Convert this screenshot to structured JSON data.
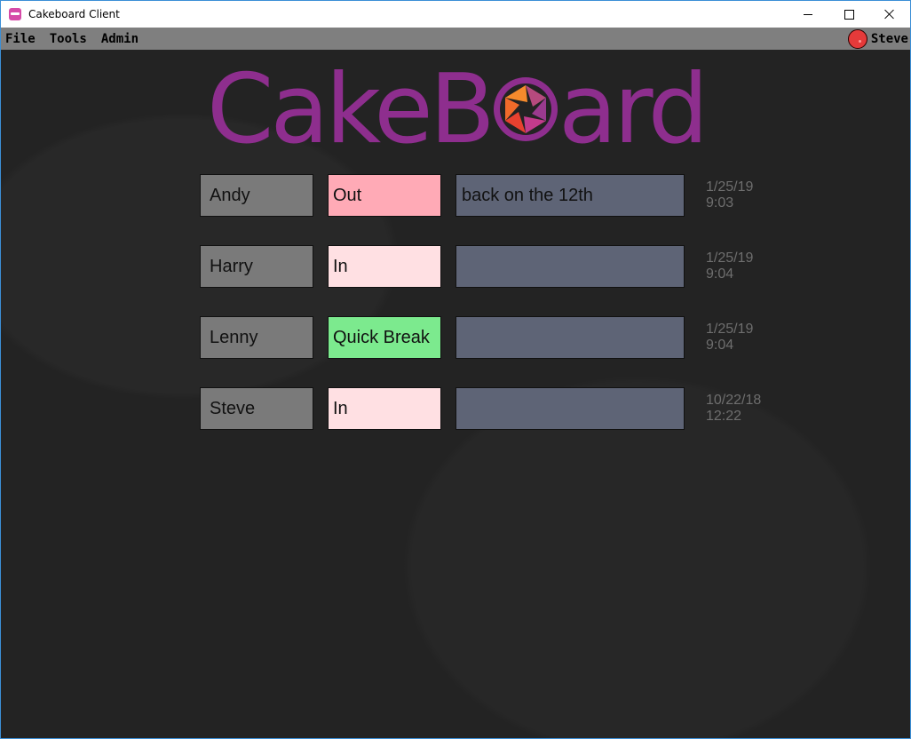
{
  "window": {
    "title": "Cakeboard Client"
  },
  "menu": {
    "file": "File",
    "tools": "Tools",
    "admin": "Admin",
    "user_name": "Steve"
  },
  "logo": {
    "text_before": "Cake",
    "text_b": "B",
    "text_after": "ard",
    "color": "#8e2e8e"
  },
  "colors": {
    "status_out": "#ffaab6",
    "status_in": "#ffe0e3",
    "status_quick_break": "#7cea8e",
    "name_bg": "#7a7a7a",
    "note_bg": "#5e6476"
  },
  "rows": [
    {
      "name": "Andy",
      "status": "Out",
      "status_color": "#ffaab6",
      "note": "back on the 12th",
      "time": "1/25/19 9:03"
    },
    {
      "name": "Harry",
      "status": "In",
      "status_color": "#ffe0e3",
      "note": "",
      "time": "1/25/19 9:04"
    },
    {
      "name": "Lenny",
      "status": "Quick Break",
      "status_color": "#7cea8e",
      "note": "",
      "time": "1/25/19 9:04"
    },
    {
      "name": "Steve",
      "status": "In",
      "status_color": "#ffe0e3",
      "note": "",
      "time": "10/22/18 12:22"
    }
  ]
}
